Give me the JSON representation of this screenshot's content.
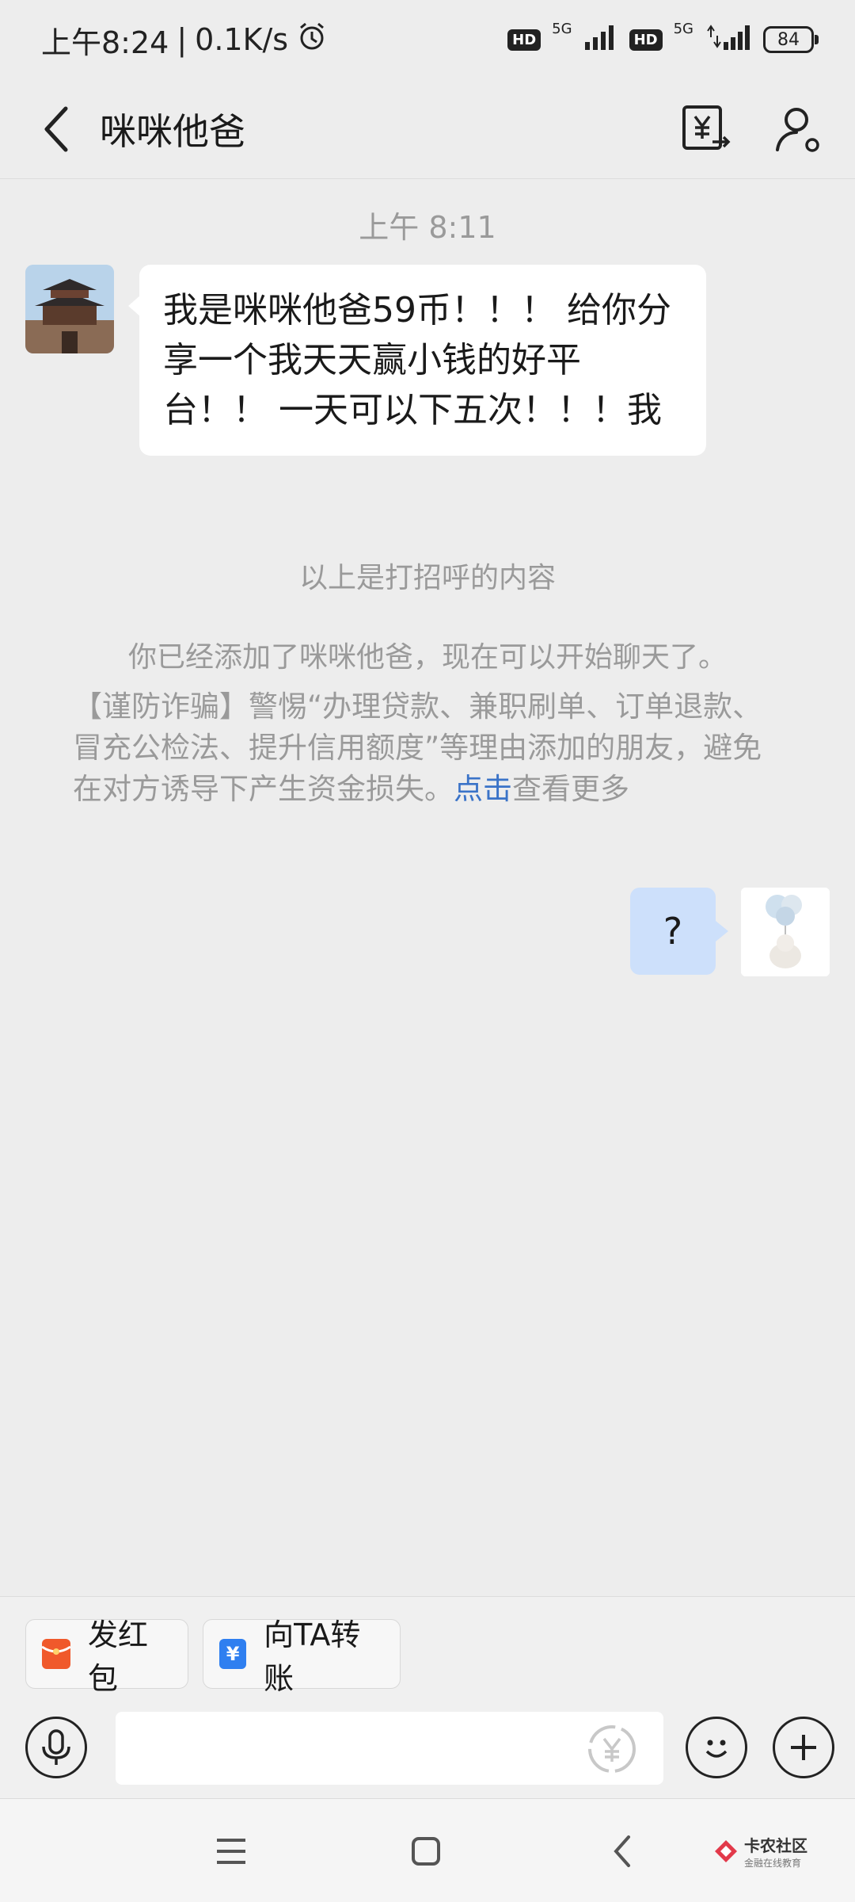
{
  "status_bar": {
    "time": "上午8:24",
    "separator": "|",
    "net_speed": "0.1K/s",
    "hd1": "HD",
    "net1": "5G",
    "hd2": "HD",
    "net2": "5G",
    "battery": "84"
  },
  "header": {
    "title": "咪咪他爸"
  },
  "chat": {
    "timestamp": "上午 8:11",
    "incoming_message": "我是咪咪他爸59币！！！ 给你分享一个我天天赢小钱的好平台！！ 一天可以下五次！！！我",
    "greeting_note": "以上是打招呼的内容",
    "added_note": "你已经添加了咪咪他爸，现在可以开始聊天了。",
    "warning_text": "【谨防诈骗】警惕“办理贷款、兼职刷单、订单退款、冒充公检法、提升信用额度”等理由添加的朋友，避免在对方诱导下产生资金损失。",
    "warning_link": "点击",
    "warning_tail": "查看更多",
    "outgoing_message": "?"
  },
  "quick_actions": {
    "red_packet": "发红包",
    "transfer": "向TA转账",
    "transfer_icon_glyph": "¥"
  },
  "input": {
    "placeholder": "",
    "pay_glyph": "¥"
  },
  "watermark": {
    "title": "卡农社区",
    "subtitle": "金融在线教育"
  },
  "colors": {
    "background": "#ededed",
    "outgoing_bubble": "#cde0fb",
    "link": "#3a73c8",
    "red_packet": "#f0592b",
    "transfer": "#2f7ff0"
  }
}
